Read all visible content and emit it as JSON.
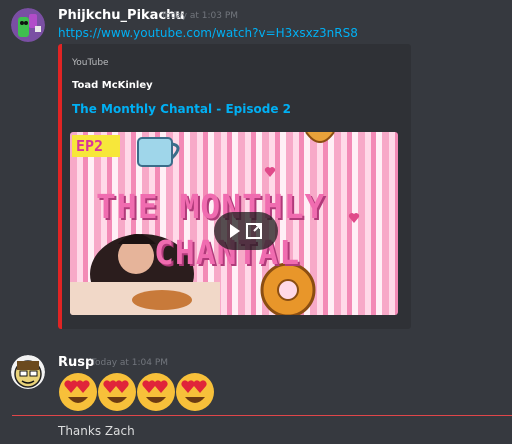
{
  "messages": [
    {
      "username": "Phijkchu_Pikachu",
      "timestamp": "Today at 1:03 PM",
      "link": "https://www.youtube.com/watch?v=H3xsxz3nRS8",
      "embed": {
        "provider": "YouTube",
        "author": "Toad McKinley",
        "title": "The Monthly Chantal - Episode 2",
        "accent_color": "#e02424",
        "thumbnail": {
          "badge": "EP2",
          "headline_line1": "THE MONTHLY",
          "headline_line2": "CHANTAL"
        }
      }
    },
    {
      "username": "Rusp",
      "timestamp": "Today at 1:04 PM",
      "emoji_name": "heart-eyes-emoji",
      "emoji_count": 4
    }
  ],
  "pending_message": "Thanks Zach",
  "colors": {
    "background": "#36393f",
    "embed_bg": "#2f3136",
    "link": "#00b0f4",
    "new_divider": "#e0464a"
  }
}
